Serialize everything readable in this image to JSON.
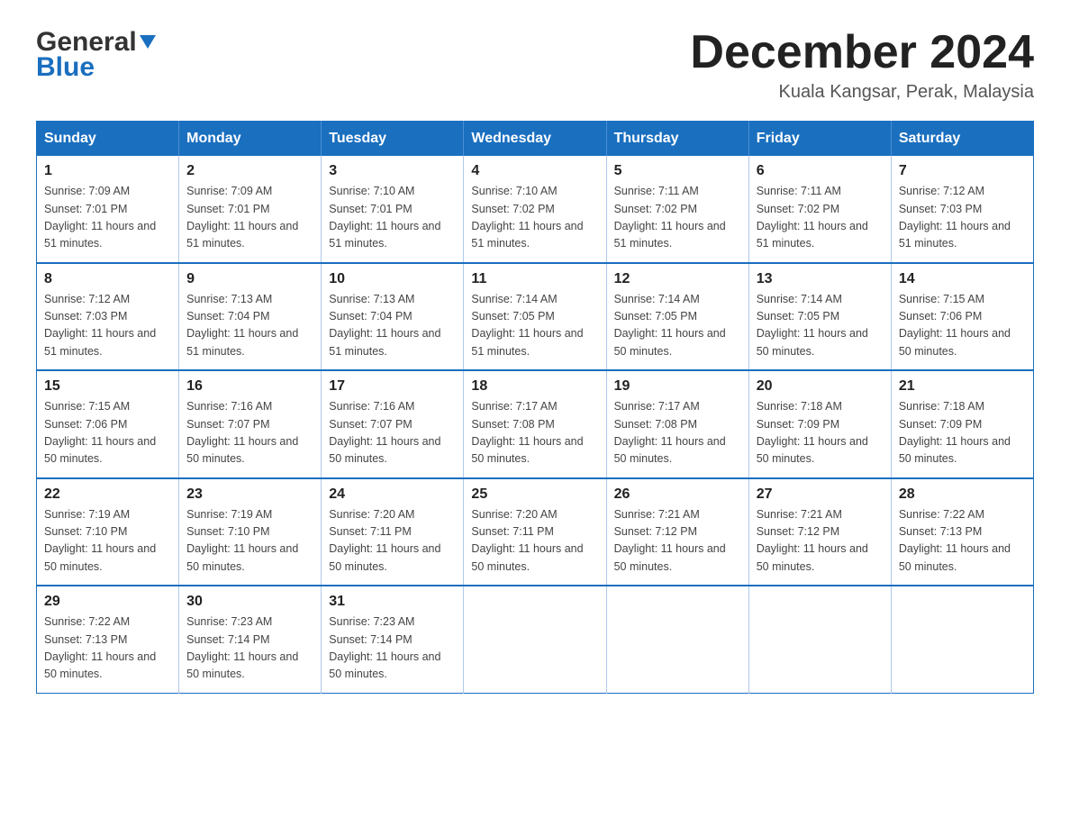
{
  "header": {
    "logo_general": "General",
    "logo_blue": "Blue",
    "title": "December 2024",
    "subtitle": "Kuala Kangsar, Perak, Malaysia"
  },
  "calendar": {
    "days_of_week": [
      "Sunday",
      "Monday",
      "Tuesday",
      "Wednesday",
      "Thursday",
      "Friday",
      "Saturday"
    ],
    "weeks": [
      [
        {
          "day": "1",
          "sunrise": "7:09 AM",
          "sunset": "7:01 PM",
          "daylight": "11 hours and 51 minutes."
        },
        {
          "day": "2",
          "sunrise": "7:09 AM",
          "sunset": "7:01 PM",
          "daylight": "11 hours and 51 minutes."
        },
        {
          "day": "3",
          "sunrise": "7:10 AM",
          "sunset": "7:01 PM",
          "daylight": "11 hours and 51 minutes."
        },
        {
          "day": "4",
          "sunrise": "7:10 AM",
          "sunset": "7:02 PM",
          "daylight": "11 hours and 51 minutes."
        },
        {
          "day": "5",
          "sunrise": "7:11 AM",
          "sunset": "7:02 PM",
          "daylight": "11 hours and 51 minutes."
        },
        {
          "day": "6",
          "sunrise": "7:11 AM",
          "sunset": "7:02 PM",
          "daylight": "11 hours and 51 minutes."
        },
        {
          "day": "7",
          "sunrise": "7:12 AM",
          "sunset": "7:03 PM",
          "daylight": "11 hours and 51 minutes."
        }
      ],
      [
        {
          "day": "8",
          "sunrise": "7:12 AM",
          "sunset": "7:03 PM",
          "daylight": "11 hours and 51 minutes."
        },
        {
          "day": "9",
          "sunrise": "7:13 AM",
          "sunset": "7:04 PM",
          "daylight": "11 hours and 51 minutes."
        },
        {
          "day": "10",
          "sunrise": "7:13 AM",
          "sunset": "7:04 PM",
          "daylight": "11 hours and 51 minutes."
        },
        {
          "day": "11",
          "sunrise": "7:14 AM",
          "sunset": "7:05 PM",
          "daylight": "11 hours and 51 minutes."
        },
        {
          "day": "12",
          "sunrise": "7:14 AM",
          "sunset": "7:05 PM",
          "daylight": "11 hours and 50 minutes."
        },
        {
          "day": "13",
          "sunrise": "7:14 AM",
          "sunset": "7:05 PM",
          "daylight": "11 hours and 50 minutes."
        },
        {
          "day": "14",
          "sunrise": "7:15 AM",
          "sunset": "7:06 PM",
          "daylight": "11 hours and 50 minutes."
        }
      ],
      [
        {
          "day": "15",
          "sunrise": "7:15 AM",
          "sunset": "7:06 PM",
          "daylight": "11 hours and 50 minutes."
        },
        {
          "day": "16",
          "sunrise": "7:16 AM",
          "sunset": "7:07 PM",
          "daylight": "11 hours and 50 minutes."
        },
        {
          "day": "17",
          "sunrise": "7:16 AM",
          "sunset": "7:07 PM",
          "daylight": "11 hours and 50 minutes."
        },
        {
          "day": "18",
          "sunrise": "7:17 AM",
          "sunset": "7:08 PM",
          "daylight": "11 hours and 50 minutes."
        },
        {
          "day": "19",
          "sunrise": "7:17 AM",
          "sunset": "7:08 PM",
          "daylight": "11 hours and 50 minutes."
        },
        {
          "day": "20",
          "sunrise": "7:18 AM",
          "sunset": "7:09 PM",
          "daylight": "11 hours and 50 minutes."
        },
        {
          "day": "21",
          "sunrise": "7:18 AM",
          "sunset": "7:09 PM",
          "daylight": "11 hours and 50 minutes."
        }
      ],
      [
        {
          "day": "22",
          "sunrise": "7:19 AM",
          "sunset": "7:10 PM",
          "daylight": "11 hours and 50 minutes."
        },
        {
          "day": "23",
          "sunrise": "7:19 AM",
          "sunset": "7:10 PM",
          "daylight": "11 hours and 50 minutes."
        },
        {
          "day": "24",
          "sunrise": "7:20 AM",
          "sunset": "7:11 PM",
          "daylight": "11 hours and 50 minutes."
        },
        {
          "day": "25",
          "sunrise": "7:20 AM",
          "sunset": "7:11 PM",
          "daylight": "11 hours and 50 minutes."
        },
        {
          "day": "26",
          "sunrise": "7:21 AM",
          "sunset": "7:12 PM",
          "daylight": "11 hours and 50 minutes."
        },
        {
          "day": "27",
          "sunrise": "7:21 AM",
          "sunset": "7:12 PM",
          "daylight": "11 hours and 50 minutes."
        },
        {
          "day": "28",
          "sunrise": "7:22 AM",
          "sunset": "7:13 PM",
          "daylight": "11 hours and 50 minutes."
        }
      ],
      [
        {
          "day": "29",
          "sunrise": "7:22 AM",
          "sunset": "7:13 PM",
          "daylight": "11 hours and 50 minutes."
        },
        {
          "day": "30",
          "sunrise": "7:23 AM",
          "sunset": "7:14 PM",
          "daylight": "11 hours and 50 minutes."
        },
        {
          "day": "31",
          "sunrise": "7:23 AM",
          "sunset": "7:14 PM",
          "daylight": "11 hours and 50 minutes."
        },
        null,
        null,
        null,
        null
      ]
    ]
  }
}
